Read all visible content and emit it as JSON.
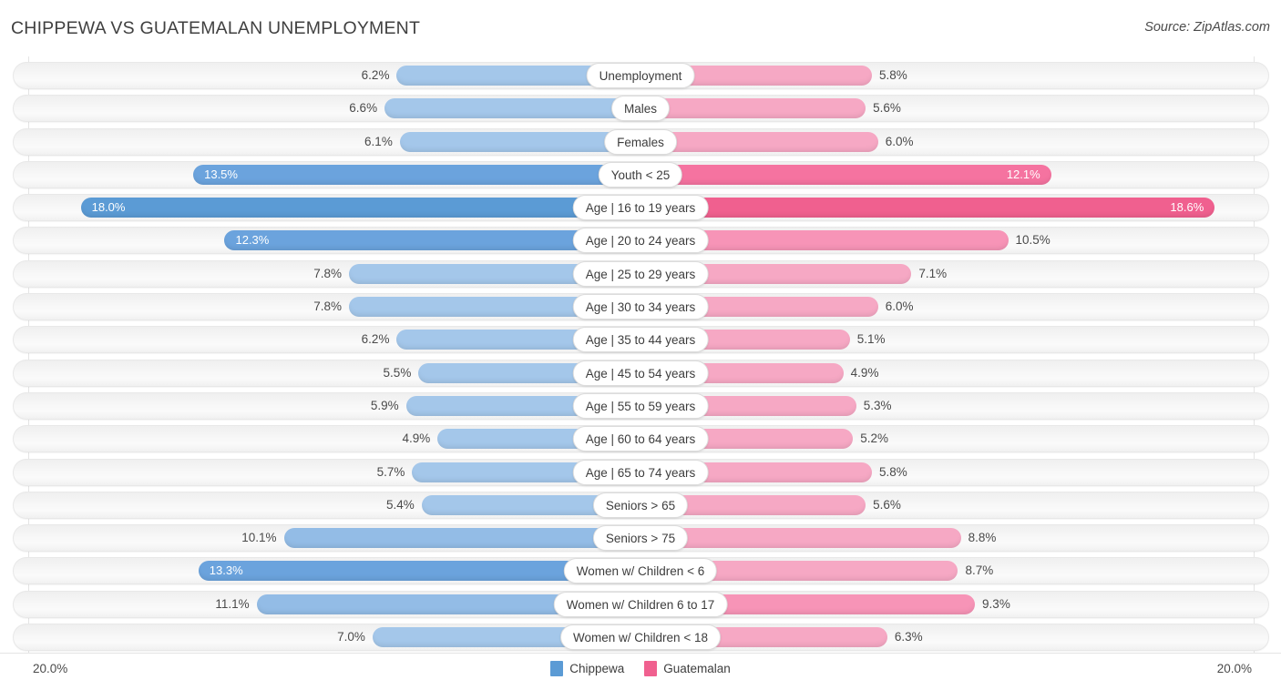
{
  "header": {
    "title": "CHIPPEWA VS GUATEMALAN UNEMPLOYMENT",
    "source": "Source: ZipAtlas.com"
  },
  "footer": {
    "axis_left": "20.0%",
    "axis_right": "20.0%",
    "legend": [
      {
        "label": "Chippewa",
        "color": "#5b9bd5"
      },
      {
        "label": "Guatemalan",
        "color": "#f0608f"
      }
    ]
  },
  "colors": {
    "left_light": "#a4c7ea",
    "left_mid": "#93bce6",
    "left_dark": "#6ba3dd",
    "left_darkest": "#5b9bd5",
    "right_light": "#f6a8c4",
    "right_mid": "#f794b7",
    "right_dark": "#f573a0",
    "right_darkest": "#f0608f",
    "track": "#f4f4f4",
    "gridline": "#e4e4e4"
  },
  "chart_data": {
    "type": "bar",
    "subtype": "diverging-bidirectional",
    "title": "CHIPPEWA VS GUATEMALAN UNEMPLOYMENT",
    "xlabel": "",
    "ylabel": "",
    "unit": "%",
    "axis_max": 20.0,
    "xlim": [
      20.0,
      20.0
    ],
    "grid": true,
    "legend_position": "bottom-center",
    "categories": [
      "Unemployment",
      "Males",
      "Females",
      "Youth < 25",
      "Age | 16 to 19 years",
      "Age | 20 to 24 years",
      "Age | 25 to 29 years",
      "Age | 30 to 34 years",
      "Age | 35 to 44 years",
      "Age | 45 to 54 years",
      "Age | 55 to 59 years",
      "Age | 60 to 64 years",
      "Age | 65 to 74 years",
      "Seniors > 65",
      "Seniors > 75",
      "Women w/ Children < 6",
      "Women w/ Children 6 to 17",
      "Women w/ Children < 18"
    ],
    "series": [
      {
        "name": "Chippewa",
        "side": "left",
        "color": "#5b9bd5",
        "values": [
          6.2,
          6.6,
          6.1,
          13.5,
          18.0,
          12.3,
          7.8,
          7.8,
          6.2,
          5.5,
          5.9,
          4.9,
          5.7,
          5.4,
          10.1,
          13.3,
          11.1,
          7.0
        ],
        "labels": [
          "6.2%",
          "6.6%",
          "6.1%",
          "13.5%",
          "18.0%",
          "12.3%",
          "7.8%",
          "7.8%",
          "6.2%",
          "5.5%",
          "5.9%",
          "4.9%",
          "5.7%",
          "5.4%",
          "10.1%",
          "13.3%",
          "11.1%",
          "7.0%"
        ]
      },
      {
        "name": "Guatemalan",
        "side": "right",
        "color": "#f0608f",
        "values": [
          5.8,
          5.6,
          6.0,
          12.1,
          18.6,
          10.5,
          7.1,
          6.0,
          5.1,
          4.9,
          5.3,
          5.2,
          5.8,
          5.6,
          8.8,
          8.7,
          9.3,
          6.3
        ],
        "labels": [
          "5.8%",
          "5.6%",
          "6.0%",
          "12.1%",
          "18.6%",
          "10.5%",
          "7.1%",
          "6.0%",
          "5.1%",
          "4.9%",
          "5.3%",
          "5.2%",
          "5.8%",
          "5.6%",
          "8.8%",
          "8.7%",
          "9.3%",
          "6.3%"
        ]
      }
    ],
    "rows": [
      {
        "label": "Unemployment",
        "left": 6.2,
        "left_label": "6.2%",
        "right": 5.8,
        "right_label": "5.8%",
        "left_inside": false,
        "right_inside": false
      },
      {
        "label": "Males",
        "left": 6.6,
        "left_label": "6.6%",
        "right": 5.6,
        "right_label": "5.6%",
        "left_inside": false,
        "right_inside": false
      },
      {
        "label": "Females",
        "left": 6.1,
        "left_label": "6.1%",
        "right": 6.0,
        "right_label": "6.0%",
        "left_inside": false,
        "right_inside": false
      },
      {
        "label": "Youth < 25",
        "left": 13.5,
        "left_label": "13.5%",
        "right": 12.1,
        "right_label": "12.1%",
        "left_inside": true,
        "right_inside": true
      },
      {
        "label": "Age | 16 to 19 years",
        "left": 18.0,
        "left_label": "18.0%",
        "right": 18.6,
        "right_label": "18.6%",
        "left_inside": true,
        "right_inside": true
      },
      {
        "label": "Age | 20 to 24 years",
        "left": 12.3,
        "left_label": "12.3%",
        "right": 10.5,
        "right_label": "10.5%",
        "left_inside": true,
        "right_inside": false
      },
      {
        "label": "Age | 25 to 29 years",
        "left": 7.8,
        "left_label": "7.8%",
        "right": 7.1,
        "right_label": "7.1%",
        "left_inside": false,
        "right_inside": false
      },
      {
        "label": "Age | 30 to 34 years",
        "left": 7.8,
        "left_label": "7.8%",
        "right": 6.0,
        "right_label": "6.0%",
        "left_inside": false,
        "right_inside": false
      },
      {
        "label": "Age | 35 to 44 years",
        "left": 6.2,
        "left_label": "6.2%",
        "right": 5.1,
        "right_label": "5.1%",
        "left_inside": false,
        "right_inside": false
      },
      {
        "label": "Age | 45 to 54 years",
        "left": 5.5,
        "left_label": "5.5%",
        "right": 4.9,
        "right_label": "4.9%",
        "left_inside": false,
        "right_inside": false
      },
      {
        "label": "Age | 55 to 59 years",
        "left": 5.9,
        "left_label": "5.9%",
        "right": 5.3,
        "right_label": "5.3%",
        "left_inside": false,
        "right_inside": false
      },
      {
        "label": "Age | 60 to 64 years",
        "left": 4.9,
        "left_label": "4.9%",
        "right": 5.2,
        "right_label": "5.2%",
        "left_inside": false,
        "right_inside": false
      },
      {
        "label": "Age | 65 to 74 years",
        "left": 5.7,
        "left_label": "5.7%",
        "right": 5.8,
        "right_label": "5.8%",
        "left_inside": false,
        "right_inside": false
      },
      {
        "label": "Seniors > 65",
        "left": 5.4,
        "left_label": "5.4%",
        "right": 5.6,
        "right_label": "5.6%",
        "left_inside": false,
        "right_inside": false
      },
      {
        "label": "Seniors > 75",
        "left": 10.1,
        "left_label": "10.1%",
        "right": 8.8,
        "right_label": "8.8%",
        "left_inside": false,
        "right_inside": false
      },
      {
        "label": "Women w/ Children < 6",
        "left": 13.3,
        "left_label": "13.3%",
        "right": 8.7,
        "right_label": "8.7%",
        "left_inside": true,
        "right_inside": false
      },
      {
        "label": "Women w/ Children 6 to 17",
        "left": 11.1,
        "left_label": "11.1%",
        "right": 9.3,
        "right_label": "9.3%",
        "left_inside": false,
        "right_inside": false
      },
      {
        "label": "Women w/ Children < 18",
        "left": 7.0,
        "left_label": "7.0%",
        "right": 6.3,
        "right_label": "6.3%",
        "left_inside": false,
        "right_inside": false
      }
    ]
  }
}
